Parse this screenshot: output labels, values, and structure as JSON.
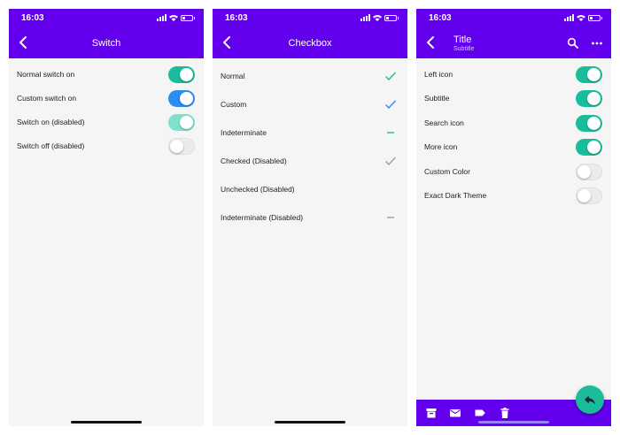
{
  "status": {
    "time": "16:03"
  },
  "colors": {
    "appbar": "#6200ee",
    "teal": "#1abc9c",
    "blue": "#2d8cf0",
    "teal_disabled": "#7fe0cd"
  },
  "screen1": {
    "title": "Switch",
    "rows": [
      {
        "label": "Normal switch on",
        "state": "on",
        "color": "#1abc9c"
      },
      {
        "label": "Custom switch on",
        "state": "on",
        "color": "#2d8cf0"
      },
      {
        "label": "Switch on (disabled)",
        "state": "on",
        "color": "#7fe0cd"
      },
      {
        "label": "Switch off (disabled)",
        "state": "off",
        "color": "#ebebeb"
      }
    ]
  },
  "screen2": {
    "title": "Checkbox",
    "rows": [
      {
        "label": "Normal",
        "mark": "check",
        "color": "#1abc9c"
      },
      {
        "label": "Custom",
        "mark": "check",
        "color": "#2d8cf0"
      },
      {
        "label": "Indeterminate",
        "mark": "dash",
        "color": "#1abc9c"
      },
      {
        "label": "Checked (Disabled)",
        "mark": "check",
        "color": "#9e9e9e"
      },
      {
        "label": "Unchecked (Disabled)",
        "mark": "none",
        "color": "#9e9e9e"
      },
      {
        "label": "Indeterminate (Disabled)",
        "mark": "dash",
        "color": "#9e9e9e"
      }
    ]
  },
  "screen3": {
    "title": "Title",
    "subtitle": "Subtitle",
    "rows": [
      {
        "label": "Left icon",
        "state": "on"
      },
      {
        "label": "Subtitle",
        "state": "on"
      },
      {
        "label": "Search icon",
        "state": "on"
      },
      {
        "label": "More icon",
        "state": "on"
      },
      {
        "label": "Custom Color",
        "state": "off"
      },
      {
        "label": "Exact Dark Theme",
        "state": "off"
      }
    ],
    "bottom_icons": [
      "archive-icon",
      "mail-icon",
      "label-icon",
      "trash-icon"
    ],
    "fab_icon": "reply-icon"
  }
}
